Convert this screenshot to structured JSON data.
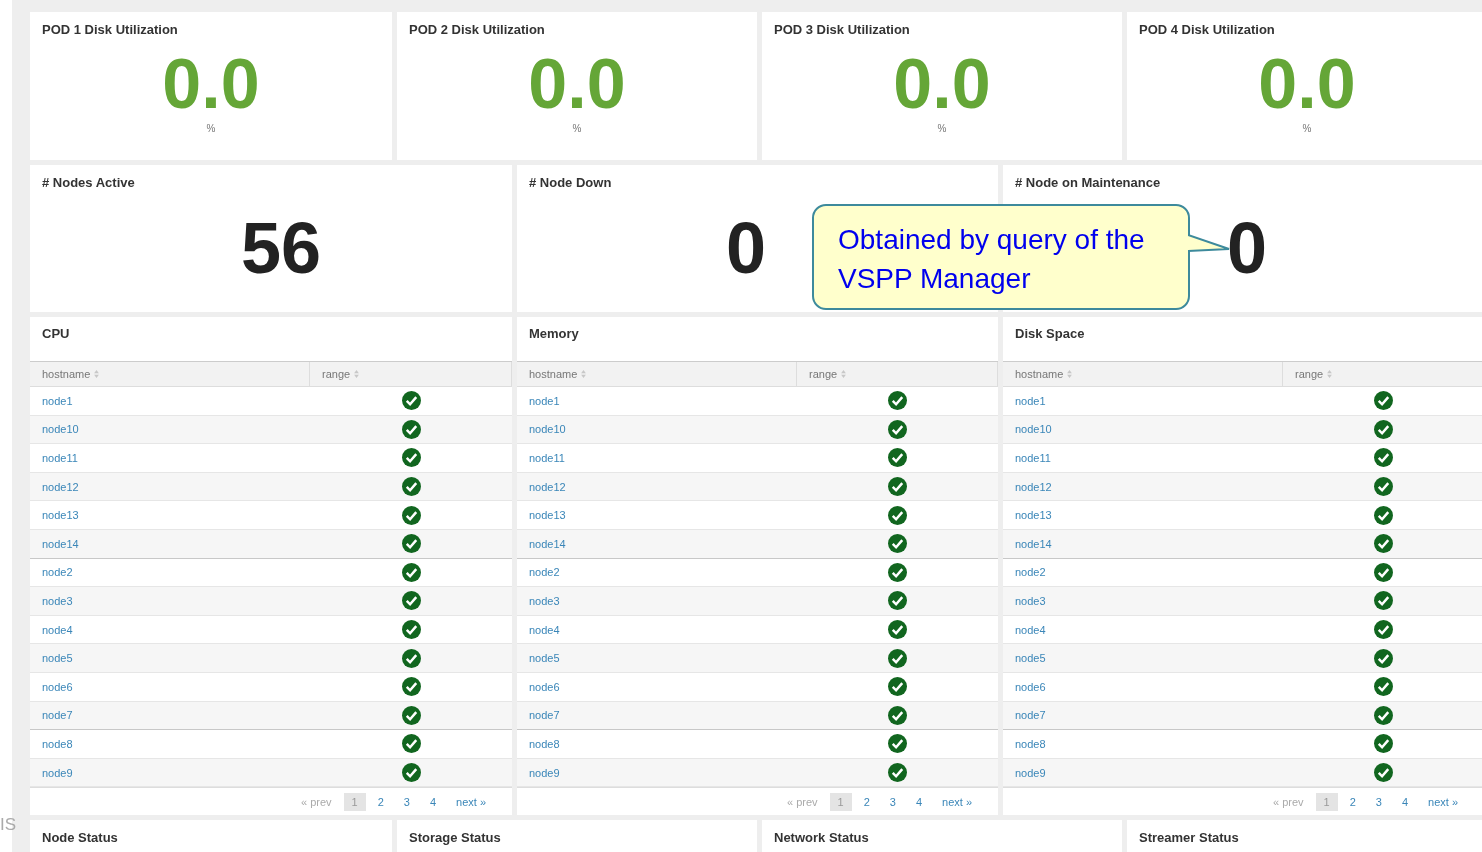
{
  "pod_panels": [
    {
      "title": "POD 1 Disk Utilization",
      "value": "0.0",
      "unit": "%"
    },
    {
      "title": "POD 2 Disk Utilization",
      "value": "0.0",
      "unit": "%"
    },
    {
      "title": "POD 3 Disk Utilization",
      "value": "0.0",
      "unit": "%"
    },
    {
      "title": "POD 4 Disk Utilization",
      "value": "0.0",
      "unit": "%"
    }
  ],
  "count_panels": [
    {
      "title": "# Nodes Active",
      "value": "56"
    },
    {
      "title": "# Node Down",
      "value": "0"
    },
    {
      "title": "# Node on Maintenance",
      "value": "0"
    }
  ],
  "tables": [
    {
      "title": "CPU",
      "columns": [
        "hostname",
        "range"
      ],
      "rows": [
        {
          "hostname": "node1",
          "ok": true
        },
        {
          "hostname": "node10",
          "ok": true
        },
        {
          "hostname": "node11",
          "ok": true
        },
        {
          "hostname": "node12",
          "ok": true
        },
        {
          "hostname": "node13",
          "ok": true
        },
        {
          "hostname": "node14",
          "ok": true
        },
        {
          "hostname": "node2",
          "ok": true
        },
        {
          "hostname": "node3",
          "ok": true
        },
        {
          "hostname": "node4",
          "ok": true
        },
        {
          "hostname": "node5",
          "ok": true
        },
        {
          "hostname": "node6",
          "ok": true
        },
        {
          "hostname": "node7",
          "ok": true
        },
        {
          "hostname": "node8",
          "ok": true
        },
        {
          "hostname": "node9",
          "ok": true
        }
      ],
      "pagination": {
        "prev": "« prev",
        "pages": [
          {
            "label": "1",
            "selected": true
          },
          {
            "label": "2",
            "selected": false
          },
          {
            "label": "3",
            "selected": false
          },
          {
            "label": "4",
            "selected": false
          }
        ],
        "next": "next »"
      }
    },
    {
      "title": "Memory",
      "columns": [
        "hostname",
        "range"
      ],
      "rows": [
        {
          "hostname": "node1",
          "ok": true
        },
        {
          "hostname": "node10",
          "ok": true
        },
        {
          "hostname": "node11",
          "ok": true
        },
        {
          "hostname": "node12",
          "ok": true
        },
        {
          "hostname": "node13",
          "ok": true
        },
        {
          "hostname": "node14",
          "ok": true
        },
        {
          "hostname": "node2",
          "ok": true
        },
        {
          "hostname": "node3",
          "ok": true
        },
        {
          "hostname": "node4",
          "ok": true
        },
        {
          "hostname": "node5",
          "ok": true
        },
        {
          "hostname": "node6",
          "ok": true
        },
        {
          "hostname": "node7",
          "ok": true
        },
        {
          "hostname": "node8",
          "ok": true
        },
        {
          "hostname": "node9",
          "ok": true
        }
      ],
      "pagination": {
        "prev": "« prev",
        "pages": [
          {
            "label": "1",
            "selected": true
          },
          {
            "label": "2",
            "selected": false
          },
          {
            "label": "3",
            "selected": false
          },
          {
            "label": "4",
            "selected": false
          }
        ],
        "next": "next »"
      }
    },
    {
      "title": "Disk Space",
      "columns": [
        "hostname",
        "range"
      ],
      "rows": [
        {
          "hostname": "node1",
          "ok": true
        },
        {
          "hostname": "node10",
          "ok": true
        },
        {
          "hostname": "node11",
          "ok": true
        },
        {
          "hostname": "node12",
          "ok": true
        },
        {
          "hostname": "node13",
          "ok": true
        },
        {
          "hostname": "node14",
          "ok": true
        },
        {
          "hostname": "node2",
          "ok": true
        },
        {
          "hostname": "node3",
          "ok": true
        },
        {
          "hostname": "node4",
          "ok": true
        },
        {
          "hostname": "node5",
          "ok": true
        },
        {
          "hostname": "node6",
          "ok": true
        },
        {
          "hostname": "node7",
          "ok": true
        },
        {
          "hostname": "node8",
          "ok": true
        },
        {
          "hostname": "node9",
          "ok": true
        }
      ],
      "pagination": {
        "prev": "« prev",
        "pages": [
          {
            "label": "1",
            "selected": true
          },
          {
            "label": "2",
            "selected": false
          },
          {
            "label": "3",
            "selected": false
          },
          {
            "label": "4",
            "selected": false
          }
        ],
        "next": "next »"
      }
    }
  ],
  "status_panels": [
    {
      "title": "Node Status"
    },
    {
      "title": "Storage Status"
    },
    {
      "title": "Network Status"
    },
    {
      "title": "Streamer Status"
    }
  ],
  "callout": {
    "text": "Obtained by query of the VSPP Manager"
  },
  "edge_fragment": "IS"
}
